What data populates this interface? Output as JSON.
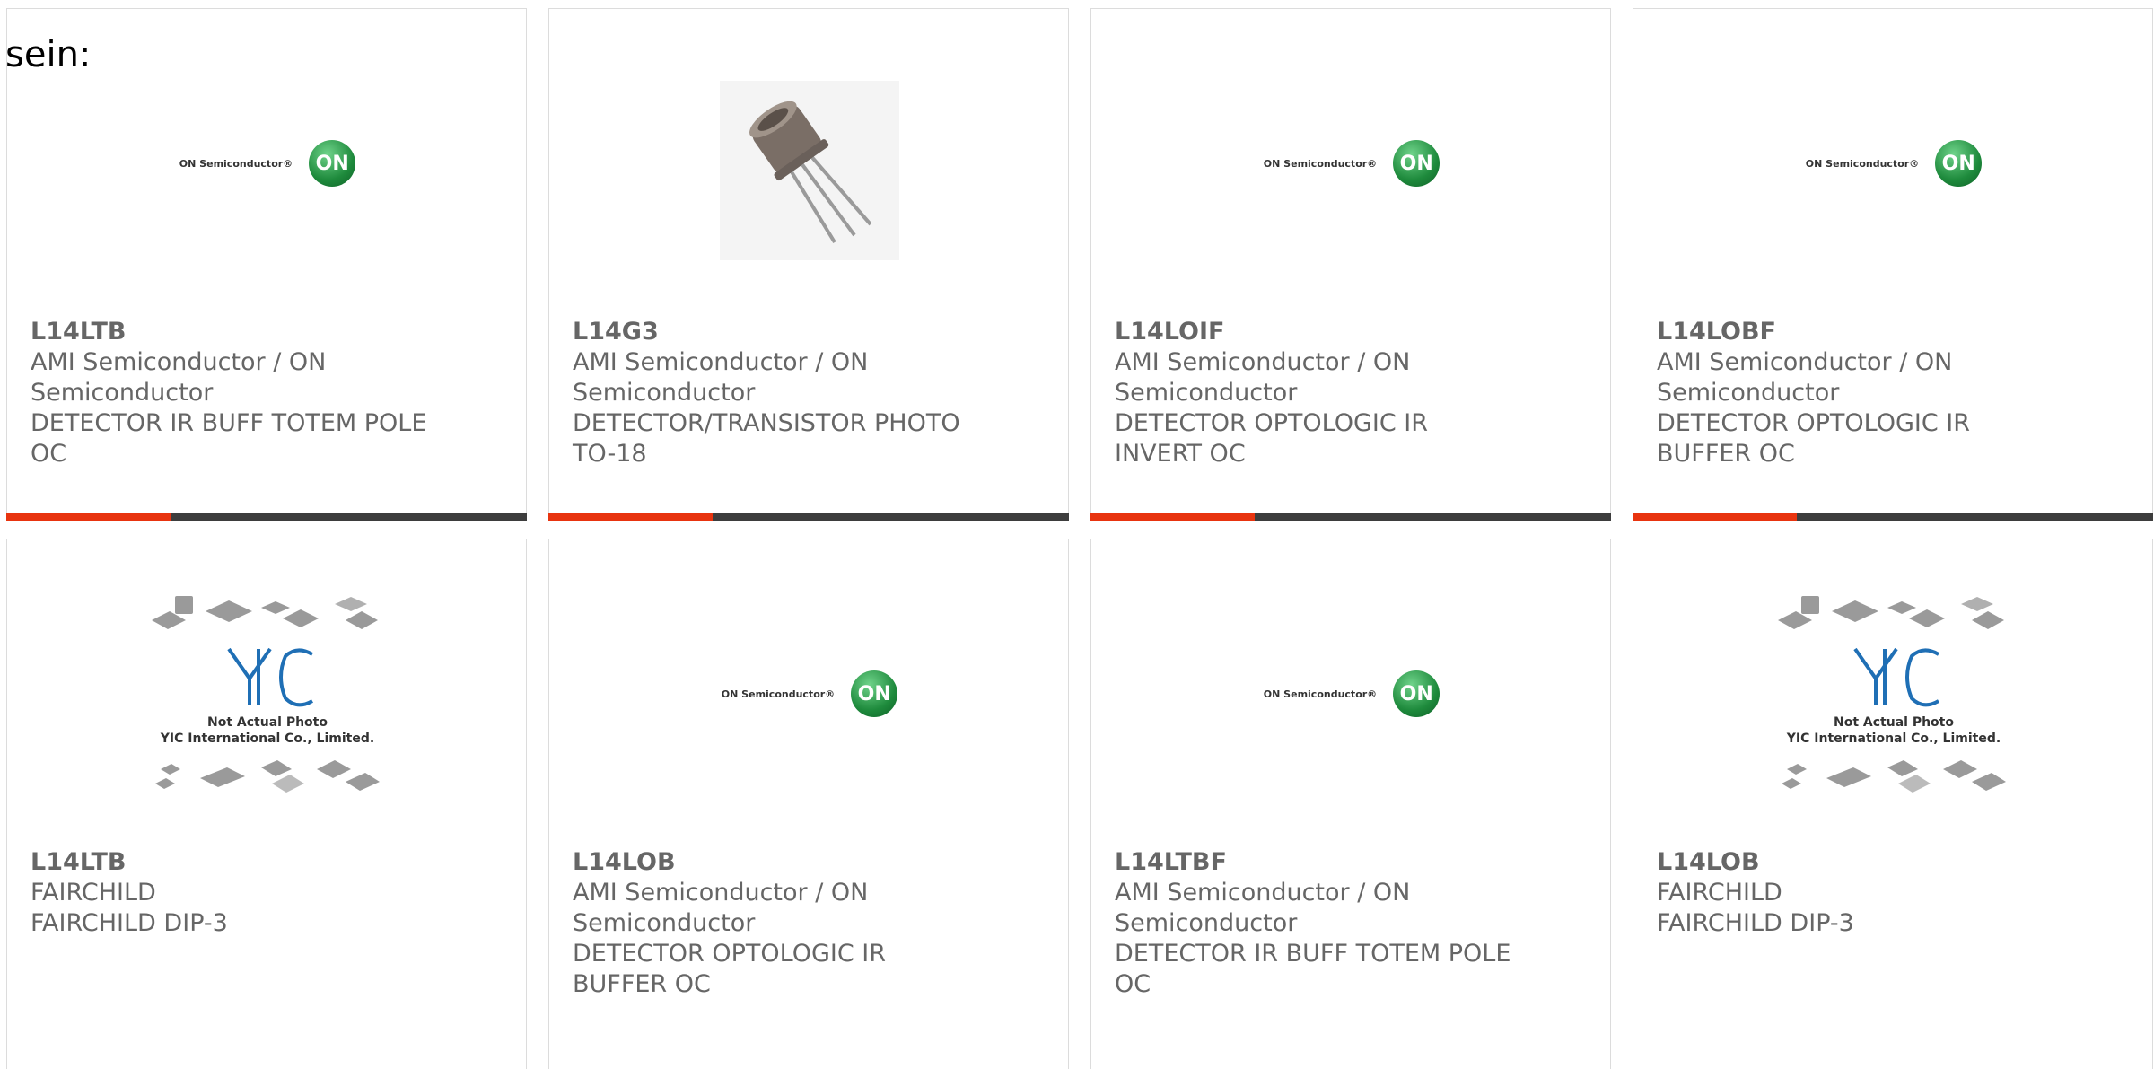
{
  "intro_text": "sein:",
  "logos": {
    "on_semi_word": "ON Semiconductor®",
    "on_semi_mark": "ON",
    "yic_mark": "YIC",
    "yic_caption_1": "Not Actual Photo",
    "yic_caption_2": "YIC International Co., Limited."
  },
  "colors": {
    "accent": "#e8340f",
    "bar": "#3d3d3d",
    "on_green": "#1e8a3c"
  },
  "products": [
    {
      "part": "L14LTB",
      "maker_1": "AMI Semiconductor / ON",
      "maker_2": "Semiconductor",
      "desc_1": "DETECTOR IR BUFF TOTEM POLE",
      "desc_2": "OC",
      "image": "on-semi-logo"
    },
    {
      "part": "L14G3",
      "maker_1": "AMI Semiconductor / ON",
      "maker_2": "Semiconductor",
      "desc_1": "DETECTOR/TRANSISTOR PHOTO",
      "desc_2": "TO-18",
      "image": "phototransistor-photo"
    },
    {
      "part": "L14LOIF",
      "maker_1": "AMI Semiconductor / ON",
      "maker_2": "Semiconductor",
      "desc_1": "DETECTOR OPTOLOGIC IR",
      "desc_2": "INVERT OC",
      "image": "on-semi-logo"
    },
    {
      "part": "L14LOBF",
      "maker_1": "AMI Semiconductor / ON",
      "maker_2": "Semiconductor",
      "desc_1": "DETECTOR OPTOLOGIC IR",
      "desc_2": "BUFFER OC",
      "image": "on-semi-logo"
    },
    {
      "part": "L14LTB",
      "maker_1": "FAIRCHILD",
      "maker_2": "FAIRCHILD DIP-3",
      "desc_1": "",
      "desc_2": "",
      "image": "yic-placeholder"
    },
    {
      "part": "L14LOB",
      "maker_1": "AMI Semiconductor / ON",
      "maker_2": "Semiconductor",
      "desc_1": "DETECTOR OPTOLOGIC IR",
      "desc_2": "BUFFER OC",
      "image": "on-semi-logo"
    },
    {
      "part": "L14LTBF",
      "maker_1": "AMI Semiconductor / ON",
      "maker_2": "Semiconductor",
      "desc_1": "DETECTOR IR BUFF TOTEM POLE",
      "desc_2": "OC",
      "image": "on-semi-logo"
    },
    {
      "part": "L14LOB",
      "maker_1": "FAIRCHILD",
      "maker_2": "FAIRCHILD DIP-3",
      "desc_1": "",
      "desc_2": "",
      "image": "yic-placeholder"
    }
  ]
}
